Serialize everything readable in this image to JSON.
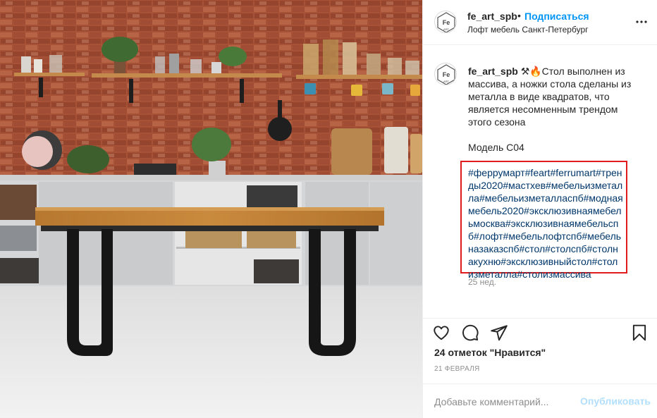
{
  "post": {
    "username": "fe_art_spb",
    "follow_label": "Подписаться",
    "location": "Лофт мебель Санкт-Петербург",
    "more_icon": "more-horizontal-icon",
    "avatar_text": "Fe",
    "avatar_small_text": "ART"
  },
  "caption": {
    "username": "fe_art_spb",
    "text": "⚒🔥Стол выполнен из массива, а ножки стола сделаны из металла в виде квадратов, что является несомненным трендом этого сезона",
    "model": "Модель С04",
    "hashtags": "#феррумарт#feart#ferrumart#тренды2020#мастхев#мебельизметалла#мебельизметаллаcпб#моднаямебель2020#эксклюзивнаямебельмосква#эксклюзивнаямебельcпб#лофт#мебельлофтспб#мебельназаказспб#стол#столспб#столнакухню#эксклюзивныйстол#столизметалла#столизмассива",
    "age": "25 нед."
  },
  "actions": {
    "like_icon": "heart-icon",
    "comment_icon": "comment-icon",
    "share_icon": "send-icon",
    "save_icon": "bookmark-icon"
  },
  "stats": {
    "likes": "24 отметок \"Нравится\"",
    "date": "21 ФЕВРАЛЯ"
  },
  "comment": {
    "placeholder": "Добавьте комментарий...",
    "publish_label": "Опубликовать"
  },
  "colors": {
    "link_blue": "#0095f6",
    "hashtag_blue": "#00376b",
    "highlight_red": "#e01b1b",
    "publish_disabled": "#b2dffc"
  }
}
